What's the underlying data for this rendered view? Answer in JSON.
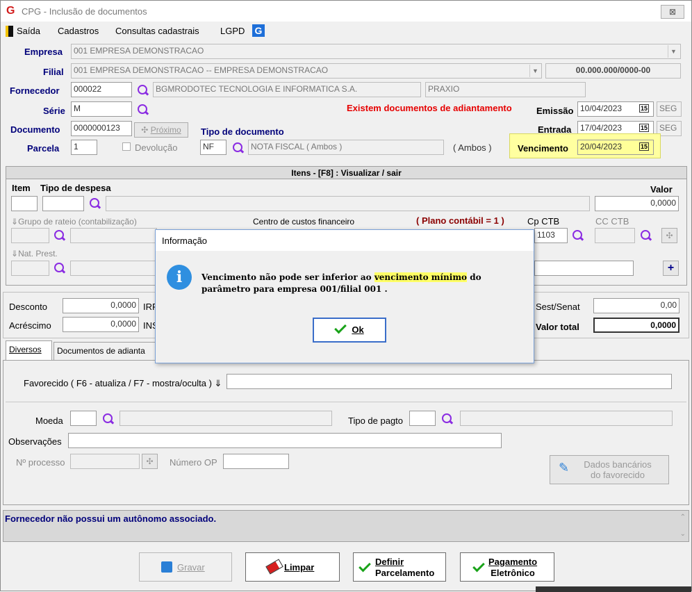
{
  "window": {
    "title": "CPG - Inclusão de documentos",
    "close": "⊠"
  },
  "menu": {
    "saida": "Saída",
    "cadastros": "Cadastros",
    "consultas": "Consultas cadastrais",
    "lgpd": "LGPD",
    "g_logo": "G"
  },
  "header": {
    "empresa_label": "Empresa",
    "empresa_value": "001 EMPRESA DEMONSTRACAO",
    "filial_label": "Filial",
    "filial_value": "001 EMPRESA DEMONSTRACAO -- EMPRESA DEMONSTRACAO",
    "cnpj": "00.000.000/0000-00",
    "fornecedor_label": "Fornecedor",
    "fornecedor_code": "000022",
    "fornecedor_name": "BGMRODOTEC TECNOLOGIA E INFORMATICA S.A.",
    "fornecedor_alt": "PRAXIO",
    "serie_label": "Série",
    "serie_value": "M",
    "adiant_warning": "Existem documentos de adiantamento",
    "emissao_label": "Emissão",
    "emissao_value": "10/04/2023",
    "emissao_day": "SEG",
    "documento_label": "Documento",
    "documento_value": "0000000123",
    "proximo": "Próximo",
    "tipo_doc_label": "Tipo de documento",
    "entrada_label": "Entrada",
    "entrada_value": "17/04/2023",
    "entrada_day": "SEG",
    "parcela_label": "Parcela",
    "parcela_value": "1",
    "devolucao": "Devolução",
    "tipo_doc_code": "NF",
    "tipo_doc_name": "NOTA FISCAL ( Ambos )",
    "tipo_doc_ambos": "( Ambos )",
    "vencimento_label": "Vencimento",
    "vencimento_value": "20/04/2023",
    "calendar_icon": "15"
  },
  "itens": {
    "title": "Itens  - [F8] : Visualizar / sair",
    "item_label": "Item",
    "tipo_despesa_label": "Tipo de despesa",
    "valor_label": "Valor",
    "valor_value": "0,0000",
    "grupo_rateio": "Grupo de rateio (contabilização)",
    "centro_custos": "Centro de custos financeiro",
    "plano_contabil": "( Plano contábil = 1 )",
    "cp_ctb": "Cp CTB",
    "cp_ctb_value": "1103",
    "cc_ctb": "CC CTB",
    "nat_prest": "Nat. Prest."
  },
  "totals": {
    "desconto_label": "Desconto",
    "desconto_value": "0,0000",
    "irrf": "IRR",
    "acrescimo_label": "Acréscimo",
    "acrescimo_value": "0,0000",
    "ins": "INS",
    "sest_label": "Sest/Senat",
    "sest_value": "0,00",
    "valor_total_label": "Valor total",
    "valor_total_value": "0,0000"
  },
  "tabs": {
    "diversos": "Diversos",
    "documentos": "Documentos de adianta"
  },
  "diversos": {
    "favorecido_label": "Favorecido ( F6 - atualiza / F7 - mostra/oculta )",
    "moeda_label": "Moeda",
    "tipo_pagto_label": "Tipo de pagto",
    "observacoes_label": "Observações",
    "nprocesso_label": "Nº processo",
    "numero_op_label": "Número OP",
    "dados_bancarios": "Dados bancários",
    "do_favorecido": "do favorecido"
  },
  "status_message": "Fornecedor não possui um autônomo associado.",
  "buttons": {
    "gravar": "Gravar",
    "limpar": "Limpar",
    "definir": "Definir",
    "parcelamento": "Parcelamento",
    "pagamento": "Pagamento",
    "eletronico": "Eletrônico"
  },
  "dialog": {
    "title": "Informação",
    "msg_part1": "Vencimento não pode ser inferior ao ",
    "msg_highlight": "vencimento mínimo",
    "msg_part2": " do",
    "msg_line2": "parâmetro para empresa 001/filial 001 .",
    "ok": "Ok",
    "info_icon": "i"
  }
}
